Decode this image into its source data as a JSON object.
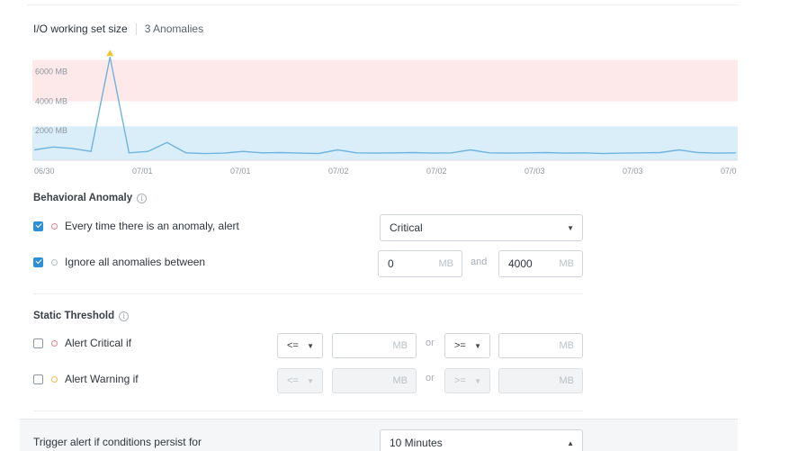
{
  "chart_header": {
    "metric": "I/O working set size",
    "anomaly_count": "3 Anomalies"
  },
  "chart_data": {
    "type": "line",
    "yticks": [
      "6000 MB",
      "4000 MB",
      "2000 MB"
    ],
    "xticks": [
      "06/30",
      "07/01",
      "07/01",
      "07/02",
      "07/02",
      "07/03",
      "07/03",
      "07/0"
    ],
    "bands": [
      {
        "kind": "critical",
        "from": 4000,
        "to": 6800,
        "color": "#fde8ea"
      },
      {
        "kind": "normal",
        "from": 0,
        "to": 2300,
        "color": "#daeefa"
      }
    ],
    "series": [
      {
        "values": [
          700,
          900,
          800,
          600,
          7000,
          500,
          600,
          1200,
          500,
          450,
          480,
          600,
          500,
          520,
          480,
          460,
          700,
          500,
          480,
          500,
          520,
          480,
          500,
          700,
          500,
          480,
          500,
          520,
          480,
          500,
          450,
          480,
          500,
          520,
          700,
          520,
          480,
          500
        ]
      }
    ],
    "anomaly_marker": "warning-triangle",
    "line_color": "#6fb3df"
  },
  "behavioral": {
    "title": "Behavioral Anomaly",
    "row1_label": "Every time there is an anomaly, alert",
    "row1_select": "Critical",
    "row2_label": "Ignore all anomalies between",
    "min_value": "0",
    "max_value": "4000",
    "unit": "MB",
    "and_label": "and"
  },
  "static": {
    "title": "Static Threshold",
    "critical_label": "Alert Critical if",
    "warning_label": "Alert Warning if",
    "op1": "<=",
    "op2": ">=",
    "or_label": "or",
    "unit": "MB"
  },
  "trigger": {
    "label": "Trigger alert if conditions persist for",
    "value": "10 Minutes"
  }
}
